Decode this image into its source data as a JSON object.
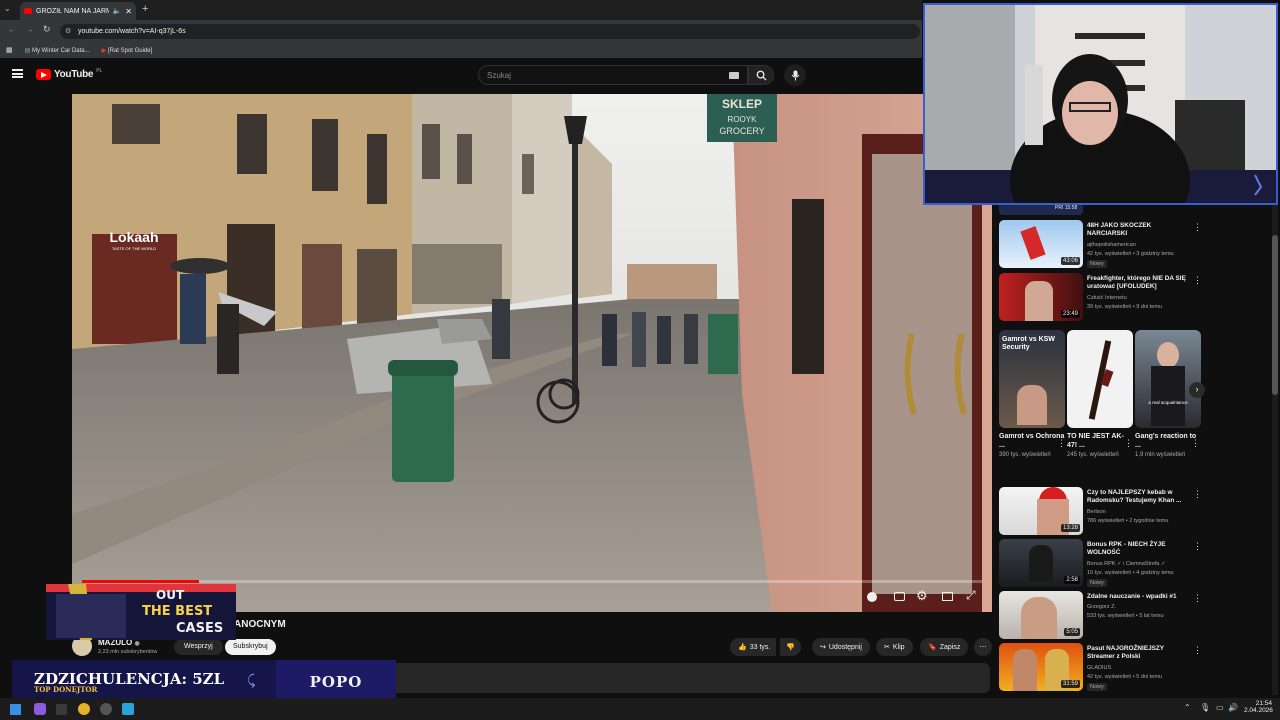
{
  "browser": {
    "tab_title": "GROZIŁ NAM NA JARMAR",
    "url": "youtube.com/watch?v=AI-q37jL-6s",
    "bookmarks": [
      "My Winter Car Data...",
      "[Rat Spot Guide]"
    ]
  },
  "youtube": {
    "logo": "YouTube",
    "region": "PL",
    "search_placeholder": "Szukaj"
  },
  "video": {
    "title_fragment": "ANOCNYM",
    "channel_name": "MAZULO",
    "subscribers": "2,23 mln subskrybentów",
    "support_label": "Wesprzyj",
    "subscribe_label": "Subskrybuj",
    "progress_fraction": 0.13,
    "scene_signs": {
      "shop_top": "SKLEP",
      "shop_mid": "ROOYK",
      "shop_bottom": "GROCERY",
      "lokaah": "Lokaah",
      "lokaah_sub": "TASTE OF THE WORLD"
    },
    "actions": {
      "likes": "33 tys.",
      "share": "Udostępnij",
      "clip": "Klip",
      "save": "Zapisz"
    }
  },
  "overlay": {
    "case_banner": [
      "OUT",
      "THE BEST",
      "CASES"
    ],
    "donor_label": "ZDZICHULENCJA: 5ZL",
    "donor_sub": "TOP DONEJTOR",
    "popo": "POPO"
  },
  "sidebar": {
    "partial_label": "PRI 15:58",
    "videos_top": [
      {
        "title": "48H JAKO SKOCZEK NARCIARSKI",
        "channel": "ajthepolishamerican",
        "meta": "42 tys. wyświetleń • 3 godziny temu",
        "badge": "Nowy",
        "duration": "43:06"
      },
      {
        "title": "Freakfighter, którego NIE DA SIĘ uratować [UFOLUDEK]",
        "channel": "Człuść Internetu",
        "meta": "39 tys. wyświetleń • 9 dni temu",
        "badge": "",
        "duration": "23:49"
      }
    ],
    "shorts": [
      {
        "title": "Gamrot vs Ochrona ...",
        "views": "390 tys. wyświetleń",
        "overlay": "Gamrot vs KSW Security"
      },
      {
        "title": "TO NIE JEST AK-47! ...",
        "views": "245 tys. wyświetleń",
        "overlay": ""
      },
      {
        "title": "Gang's reaction to ...",
        "views": "1,9 mln wyświetleń",
        "overlay": "a real acquaintance"
      }
    ],
    "videos_bottom": [
      {
        "title": "Czy to NAJLEPSZY kebab w Radomsku? Testujemy Khan ...",
        "channel": "Berlson",
        "meta": "786 wyświetleń • 2 tygodnie temu",
        "badge": "",
        "duration": "13:28"
      },
      {
        "title": "Bonus RPK - NIECH ŻYJE WOLNOŚĆ",
        "channel": "Bonus RPK ✓ i CiemnaStrefa ✓",
        "meta": "10 tys. wyświetleń • 4 godziny temu",
        "badge": "Nowy",
        "duration": "2:58"
      },
      {
        "title": "Zdalne nauczanie - wpadki #1",
        "channel": "Grzegorz Z.",
        "meta": "533 tys. wyświetleń • 5 lat temu",
        "badge": "",
        "duration": "5:05"
      },
      {
        "title": "Pasut NAJGROŹNIEJSZY Streamer z Polski",
        "channel": "GLADIUS",
        "meta": "42 tys. wyświetleń • 5 dni temu",
        "badge": "Nowy",
        "duration": "31:59"
      }
    ]
  },
  "taskbar": {
    "time": "21:54",
    "date": "2.04.2026"
  }
}
